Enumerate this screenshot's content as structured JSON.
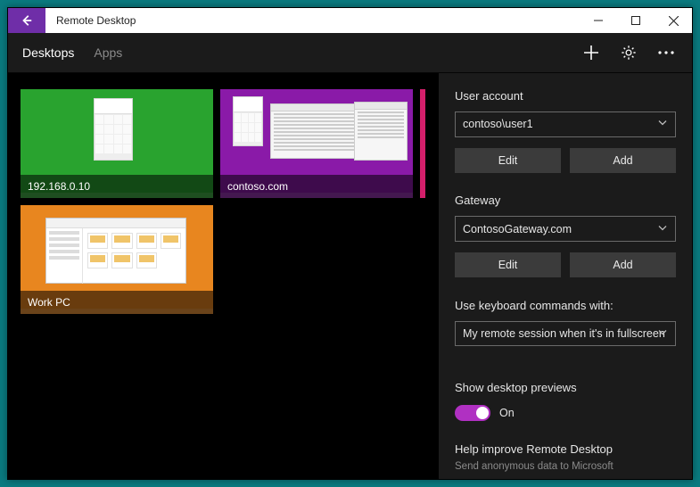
{
  "titlebar": {
    "title": "Remote Desktop"
  },
  "tabs": [
    "Desktops",
    "Apps"
  ],
  "desktops": [
    {
      "label": "192.168.0.10"
    },
    {
      "label": "contoso.com"
    },
    {
      "label": "Work PC"
    }
  ],
  "panel": {
    "user_account": {
      "label": "User account",
      "value": "contoso\\user1",
      "edit": "Edit",
      "add": "Add"
    },
    "gateway": {
      "label": "Gateway",
      "value": "ContosoGateway.com",
      "edit": "Edit",
      "add": "Add"
    },
    "keyboard": {
      "label": "Use keyboard commands with:",
      "value": "My remote session when it's in fullscreen"
    },
    "previews": {
      "label": "Show desktop previews",
      "state": "On",
      "on": true,
      "accent": "#b030c2"
    },
    "help_improve": {
      "label": "Help improve Remote Desktop",
      "sub": "Send anonymous data to Microsoft"
    }
  }
}
